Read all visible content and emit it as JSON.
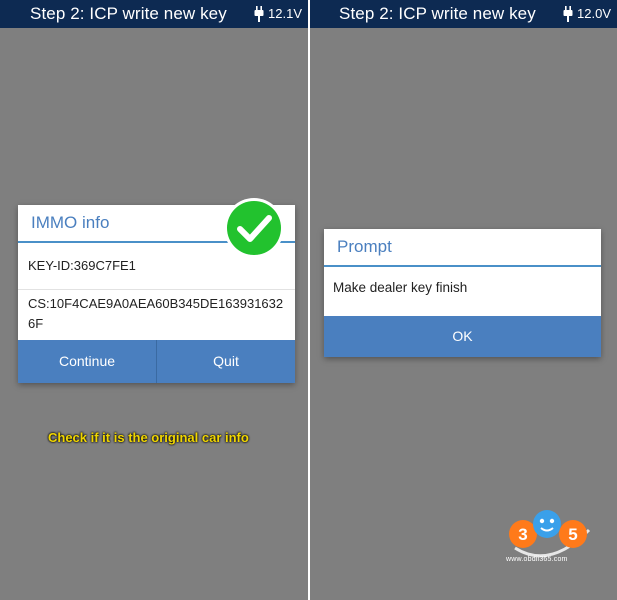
{
  "left_screen": {
    "title": "Step 2: ICP write new key",
    "voltage": "12.1V",
    "dialog": {
      "title": "IMMO info",
      "key_id": "KEY-ID:369C7FE1",
      "cs": "CS:10F4CAE9A0AEA60B345DE1639316326F",
      "continue_label": "Continue",
      "quit_label": "Quit"
    },
    "caption": "Check if it is the original car info"
  },
  "right_screen": {
    "title": "Step 2: ICP write new key",
    "voltage": "12.0V",
    "dialog": {
      "title": "Prompt",
      "message": "Make dealer key finish",
      "ok_label": "OK"
    }
  },
  "watermark": {
    "logo_text": "365",
    "url": "www.obdii365.com"
  },
  "colors": {
    "titlebar": "#0d2a52",
    "background": "#7f7f7f",
    "accent": "#4a7fbf",
    "check": "#22c22e",
    "caption": "#f1d600"
  },
  "icons": [
    "plug-icon",
    "checkmark-icon"
  ]
}
